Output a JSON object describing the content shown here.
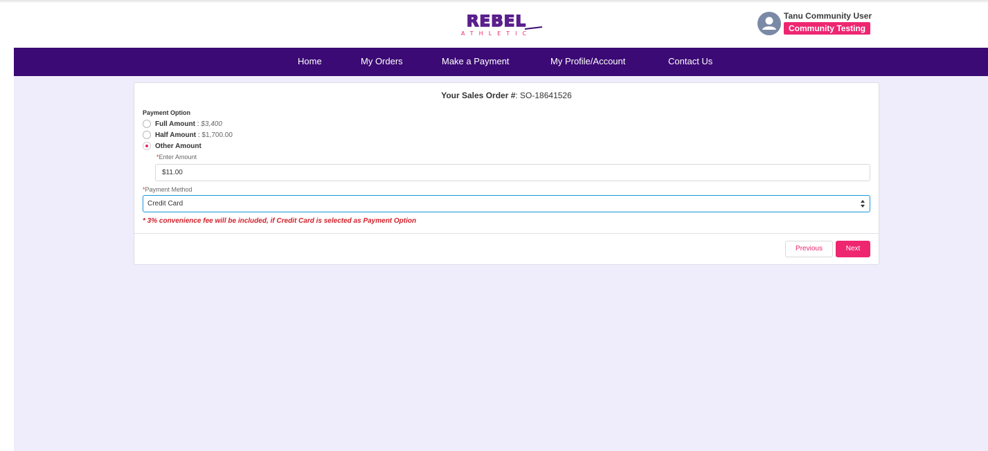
{
  "header": {
    "logo_text": "REBEL",
    "logo_subtext": "ATHLETIC",
    "user_name": "Tanu Community User",
    "user_badge": "Community Testing",
    "avatar_icon": "user-avatar-icon"
  },
  "nav": {
    "items": [
      {
        "label": "Home"
      },
      {
        "label": "My Orders"
      },
      {
        "label": "Make a Payment"
      },
      {
        "label": "My Profile/Account"
      },
      {
        "label": "Contact Us"
      }
    ]
  },
  "order": {
    "title_label": "Your Sales Order #",
    "title_sep": ": ",
    "number": "SO-18641526"
  },
  "payment_option": {
    "label": "Payment Option",
    "options": [
      {
        "label": "Full Amount",
        "sep": " : ",
        "value": "$3,400",
        "selected": false
      },
      {
        "label": "Half Amount",
        "sep": " : ",
        "value": "$1,700.00",
        "selected": false
      },
      {
        "label": "Other Amount",
        "sep": "",
        "value": "",
        "selected": true
      }
    ]
  },
  "amount": {
    "required_mark": "*",
    "label": "Enter Amount",
    "value": "$11.00"
  },
  "payment_method": {
    "required_mark": "*",
    "label": "Payment Method",
    "selected": "Credit Card"
  },
  "fee_note": "* 3% convenience fee will be included, if Credit Card is selected as Payment Option",
  "buttons": {
    "previous": "Previous",
    "next": "Next"
  },
  "colors": {
    "nav_bg": "#3b0a74",
    "accent": "#ee2670",
    "page_bg": "#efedfb",
    "logo_purple": "#5a1f8c"
  }
}
